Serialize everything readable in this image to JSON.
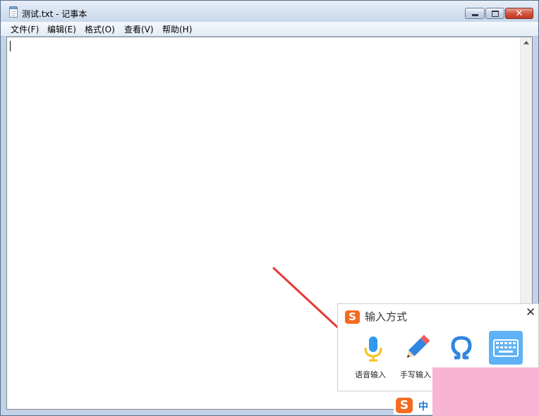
{
  "window": {
    "title": "测试.txt - 记事本",
    "close_glyph": "✕"
  },
  "menu": {
    "items": [
      {
        "label": "文件(F)"
      },
      {
        "label": "编辑(E)"
      },
      {
        "label": "格式(O)"
      },
      {
        "label": "查看(V)"
      },
      {
        "label": "帮助(H)"
      }
    ]
  },
  "editor": {
    "content": ""
  },
  "ime_panel": {
    "logo": "S",
    "title": "输入方式",
    "close_glyph": "✕",
    "tools": [
      {
        "label": "语音输入",
        "icon": "microphone-icon"
      },
      {
        "label": "手写输入",
        "icon": "pencil-icon"
      },
      {
        "label": "",
        "icon": "omega-icon"
      },
      {
        "label": "",
        "icon": "keyboard-icon"
      }
    ]
  },
  "ime_bar": {
    "logo": "S",
    "mode": "中"
  },
  "colors": {
    "ime_brand": "#f26b21",
    "arrow": "#e53935",
    "keyboard_tile": "#5fb2f5",
    "overlay": "#f8b5d3"
  }
}
